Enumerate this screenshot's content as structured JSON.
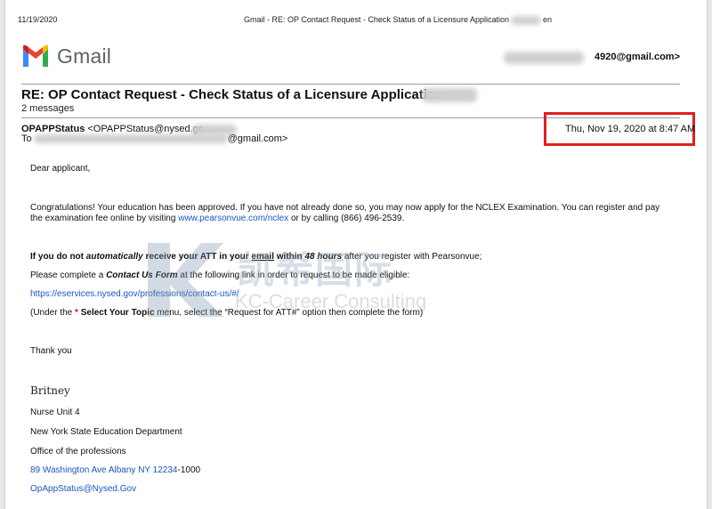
{
  "print_header": {
    "date": "11/19/2020",
    "title": "Gmail - RE: OP Contact Request - Check Status of a Licensure Application",
    "title_tail": "en"
  },
  "gmail": {
    "logo_text": "Gmail",
    "account_visible": "4920@gmail.com>"
  },
  "thread": {
    "subject": "RE: OP Contact Request - Check Status of a Licensure Application",
    "message_count": "2 messages"
  },
  "message": {
    "from_name": "OPAPPStatus",
    "from_email": "<OPAPPStatus@nysed.go",
    "to_label": "To",
    "to_visible": "@gmail.com>",
    "date": "Thu, Nov 19, 2020 at 8:47 AM"
  },
  "body": {
    "greeting": "Dear applicant,",
    "para1_a": "Congratulations! Your education has been approved. If you have not already done so, you may now apply for the NCLEX Examination. You can register and pay",
    "para1_b": "the examination fee online by visiting",
    "para1_link": "www.pearsonvue.com/nclex",
    "para1_c": "or by calling (866) 496-2539.",
    "p2_a": "If you do not",
    "p2_b": "automatically",
    "p2_c": "receive your ATT in your",
    "p2_d": "email",
    "p2_e": "within",
    "p2_f": "48 hours",
    "p2_g": "after you register with Pearsonvue;",
    "p3_a": "Please complete a",
    "p3_b": "Contact Us Form",
    "p3_c": "at the following link in order to request to be made eligible:",
    "contact_link": "https://eservices.nysed.gov/professions/contact-us/#/",
    "p4_a": "(Under the",
    "p4_star": "*",
    "p4_b": "Select Your Topic",
    "p4_c": "menu, select the “Request for ATT#” option then complete the form)",
    "thanks": "Thank you"
  },
  "signature": {
    "name": "Britney",
    "unit": "Nurse Unit 4",
    "department": "New York State Education Department",
    "office": "Office of the professions",
    "address_link": "89 Washington Ave Albany NY 12234",
    "address_suffix": "-1000",
    "email_link": "OpAppStatus@Nysed.Gov"
  },
  "watermark": {
    "cn": "凯希国际",
    "en": "KC-Career Consulting"
  },
  "colors": {
    "highlight_box": "#e02020",
    "link": "#1a55c4",
    "gmail_red": "#ea4335",
    "gmail_blue": "#4285f4",
    "gmail_green": "#34a853",
    "gmail_yellow": "#fbbc04"
  }
}
